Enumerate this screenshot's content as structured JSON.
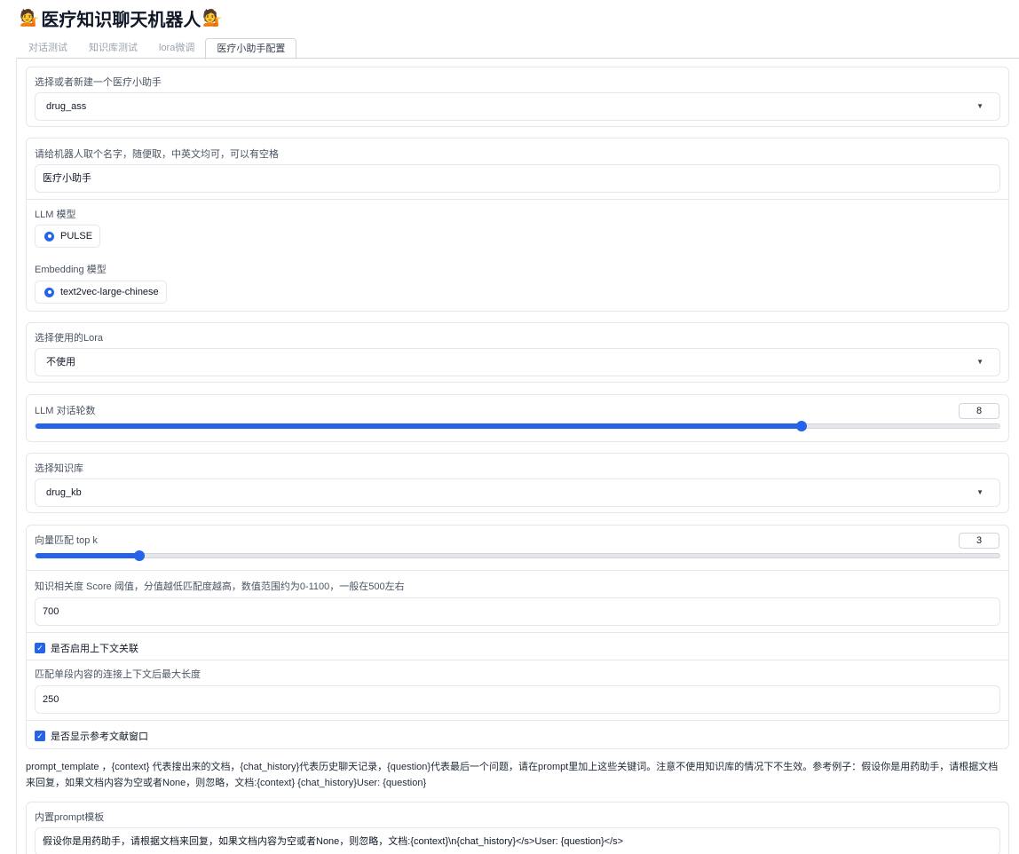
{
  "header": {
    "emoji_left": "💁",
    "title": "医疗知识聊天机器人",
    "emoji_right": "💁"
  },
  "tabs": [
    {
      "label": "对话测试",
      "active": false
    },
    {
      "label": "知识库测试",
      "active": false
    },
    {
      "label": "lora微调",
      "active": false
    },
    {
      "label": "医疗小助手配置",
      "active": true
    }
  ],
  "assistant_select": {
    "label": "选择或者新建一个医疗小助手",
    "value": "drug_ass"
  },
  "bot_name": {
    "label": "请给机器人取个名字，随便取，中英文均可，可以有空格",
    "value": "医疗小助手"
  },
  "llm_model": {
    "label": "LLM 模型",
    "selected": "PULSE"
  },
  "embedding_model": {
    "label": "Embedding 模型",
    "selected": "text2vec-large-chinese"
  },
  "lora_select": {
    "label": "选择使用的Lora",
    "value": "不使用"
  },
  "llm_rounds": {
    "label": "LLM 对话轮数",
    "value": "8",
    "fraction": 0.795
  },
  "kb_select": {
    "label": "选择知识库",
    "value": "drug_kb"
  },
  "top_k": {
    "label": "向量匹配 top k",
    "value": "3",
    "fraction": 0.108
  },
  "score_threshold": {
    "label": "知识相关度 Score 阈值，分值越低匹配度越高，数值范围约为0-1100，一般在500左右",
    "value": "700"
  },
  "context_toggle": {
    "label": "是否启用上下文关联",
    "checked": true
  },
  "chunk_size": {
    "label": "匹配单段内容的连接上下文后最大长度",
    "value": "250"
  },
  "show_refs": {
    "label": "是否显示参考文献窗口",
    "checked": true
  },
  "prompt_desc": "prompt_template ，{context} 代表搜出来的文档，{chat_history}代表历史聊天记录，{question}代表最后一个问题，请在prompt里加上这些关键词。注意不使用知识库的情况下不生效。参考例子：假设你是用药助手，请根据文档来回复，如果文档内容为空或者None，则忽略，文档:{context} {chat_history}User: {question}",
  "prompt_template": {
    "label": "内置prompt模板",
    "value": "假设你是用药助手，请根据文档来回复，如果文档内容为空或者None，则忽略，文档:{context}\\n{chat_history}</s>User: {question}</s>"
  },
  "icons": {
    "checkbox": "check-icon",
    "dropdown": "caret-down-icon",
    "radio": "radio-dot-icon"
  },
  "colors": {
    "accent": "#2563eb",
    "border": "#e5e7eb",
    "muted_text": "#9ca3af"
  }
}
